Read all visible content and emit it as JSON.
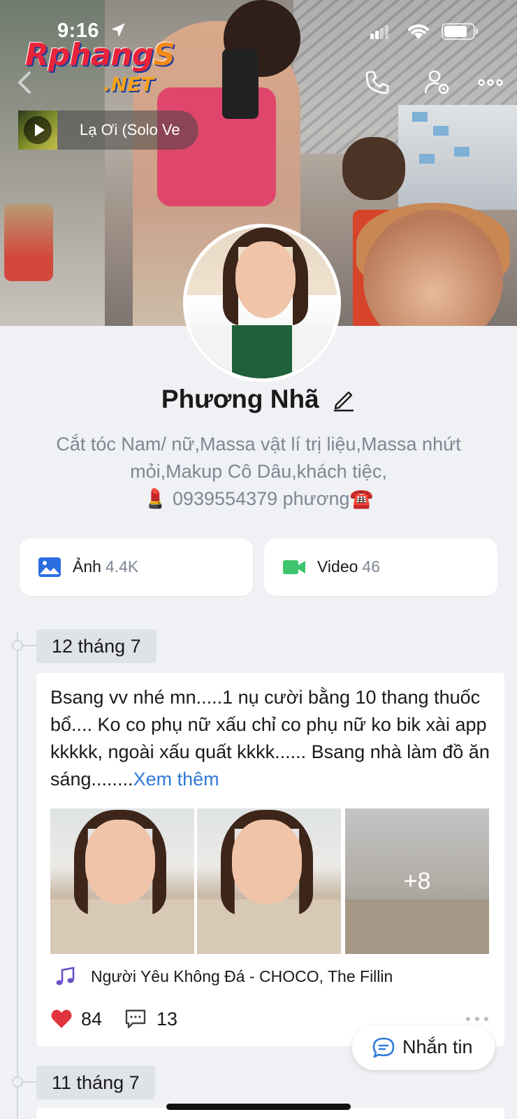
{
  "status_bar": {
    "time": "9:16"
  },
  "watermark": {
    "line1": "Rphang",
    "line1_end": "S",
    "line2": ".NET"
  },
  "music": {
    "title": "Lạ Ơi (Solo Ve"
  },
  "profile": {
    "name": "Phương Nhã",
    "bio_line1": "Cắt tóc Nam/ nữ,Massa vật lí trị liệu,Massa nhứt",
    "bio_line2": "mỏi,Makup Cô Dâu,khách tiệc,",
    "bio_line3_emoji1": "💄",
    "bio_line3_text": " 0939554379  phương",
    "bio_line3_emoji2": "☎️"
  },
  "media": {
    "photos_label": "Ảnh",
    "photos_count": "4.4K",
    "videos_label": "Video",
    "videos_count": "46"
  },
  "timeline": [
    {
      "date": "12 tháng 7",
      "text": "Bsang vv nhé mn.....1 nụ cười bằng 10 thang thuốc bổ.... Ko co phụ nữ xấu chỉ co phụ nữ ko bik xài app kkkkk, ngoài xấu quất kkkk...... Bsang  nhà làm đồ ăn sáng........",
      "more": "Xem thêm",
      "extra_photos": "+8",
      "song": "Người Yêu Không Đá - CHOCO, The Fillin",
      "likes": "84",
      "comments": "13"
    },
    {
      "date": "11 tháng 7"
    }
  ],
  "message_button": {
    "label": "Nhắn tin"
  },
  "colors": {
    "accent": "#2f7ad8",
    "heart": "#e0353e",
    "video_green": "#3ec46d",
    "photo_blue": "#2a6ee0"
  }
}
